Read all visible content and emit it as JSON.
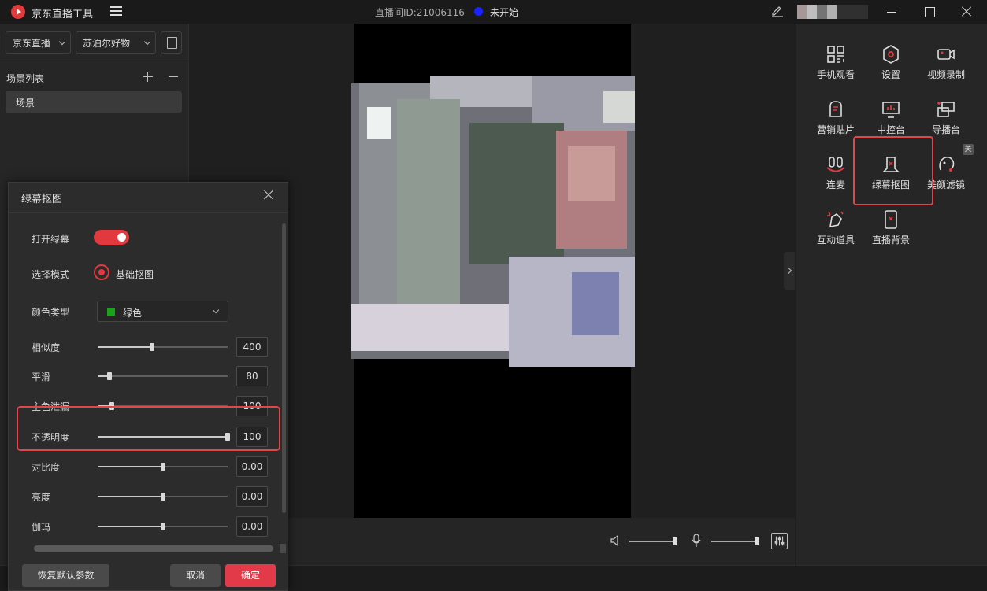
{
  "titlebar": {
    "app_title": "京东直播工具",
    "room_id": "直播间ID:21006116",
    "status": "未开始",
    "status_color": "#1a22ff"
  },
  "left_panel": {
    "select1": "京东直播",
    "select2": "苏泊尔好物",
    "scene_list_title": "场景列表",
    "scene_item": "场景"
  },
  "tools": [
    {
      "label": "手机观看",
      "icon": "qr-code-icon"
    },
    {
      "label": "设置",
      "icon": "gear-icon"
    },
    {
      "label": "视频录制",
      "icon": "video-record-icon"
    },
    {
      "label": "营销贴片",
      "icon": "sticker-icon"
    },
    {
      "label": "中控台",
      "icon": "dashboard-icon"
    },
    {
      "label": "导播台",
      "icon": "switcher-icon"
    },
    {
      "label": "连麦",
      "icon": "co-host-icon"
    },
    {
      "label": "绿幕抠图",
      "icon": "green-screen-icon"
    },
    {
      "label": "美颜滤镜",
      "icon": "beauty-filter-icon"
    },
    {
      "label": "互动道具",
      "icon": "props-icon"
    },
    {
      "label": "直播背景",
      "icon": "background-icon"
    }
  ],
  "beauty_badge": "关",
  "dialog": {
    "title": "绿幕抠图",
    "toggle_label": "打开绿幕",
    "toggle_on": true,
    "mode_label": "选择模式",
    "mode_value": "基础抠图",
    "color_label": "颜色类型",
    "color_value": "绿色",
    "color_swatch": "#1aa31a",
    "sliders": [
      {
        "label": "相似度",
        "value": "400",
        "fraction": 0.42
      },
      {
        "label": "平滑",
        "value": "80",
        "fraction": 0.09
      },
      {
        "label": "主色泄漏",
        "value": "100",
        "fraction": 0.11
      },
      {
        "label": "不透明度",
        "value": "100",
        "fraction": 1.0
      },
      {
        "label": "对比度",
        "value": "0.00",
        "fraction": 0.5
      },
      {
        "label": "亮度",
        "value": "0.00",
        "fraction": 0.5
      },
      {
        "label": "伽玛",
        "value": "0.00",
        "fraction": 0.5
      }
    ],
    "reset_button": "恢复默认参数",
    "cancel_button": "取消",
    "ok_button": "确定"
  },
  "audio": {
    "speaker_level": 1.0,
    "mic_level": 1.0
  },
  "accent_color": "#e2393f"
}
